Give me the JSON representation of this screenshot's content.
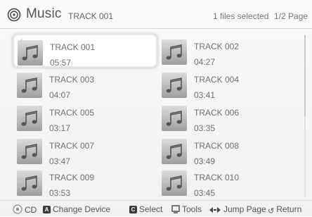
{
  "header": {
    "app_title": "Music",
    "current_track": "TRACK 001",
    "selection_status": "1 files selected",
    "page_indicator": "1/2 Page",
    "app_icon": "disc-icon"
  },
  "tracks": [
    {
      "title": "TRACK 001",
      "duration": "05:57",
      "selected": true
    },
    {
      "title": "TRACK 002",
      "duration": "04:27",
      "selected": false
    },
    {
      "title": "TRACK 003",
      "duration": "04:07",
      "selected": false
    },
    {
      "title": "TRACK 004",
      "duration": "03:41",
      "selected": false
    },
    {
      "title": "TRACK 005",
      "duration": "03:17",
      "selected": false
    },
    {
      "title": "TRACK 006",
      "duration": "03:35",
      "selected": false
    },
    {
      "title": "TRACK 007",
      "duration": "03:47",
      "selected": false
    },
    {
      "title": "TRACK 008",
      "duration": "03:49",
      "selected": false
    },
    {
      "title": "TRACK 009",
      "duration": "03:53",
      "selected": false
    },
    {
      "title": "TRACK 010",
      "duration": "03:45",
      "selected": false
    }
  ],
  "track_icon": "music-note-icon",
  "footer": {
    "cd_label": "CD",
    "a_key": "A",
    "change_device_label": "Change Device",
    "c_key": "C",
    "select_label": "Select",
    "tools_label": "Tools",
    "jump_page_label": "Jump Page",
    "return_label": "Return"
  }
}
